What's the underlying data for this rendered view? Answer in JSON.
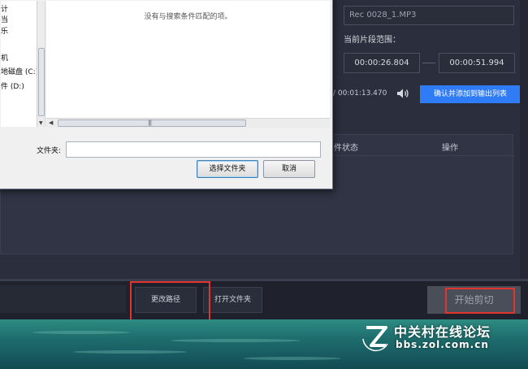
{
  "dialog": {
    "tree_items": [
      "计",
      "当",
      "乐",
      "机",
      "地磁盘 (C:)",
      "件 (D:)"
    ],
    "empty_message": "没有与搜索条件匹配的项。",
    "folder_label": "文件夹:",
    "folder_value": "",
    "select_folder_label": "选择文件夹",
    "cancel_label": "取消"
  },
  "editor": {
    "file_name": "Rec 0028_1.MP3",
    "range_label": "当前片段范围：",
    "start_time": "00:00:26.804",
    "end_time": "00:00:51.994",
    "total_time": "/ 00:01:13.470",
    "confirm_label": "确认并添加到输出列表"
  },
  "output_list": {
    "columns": [
      "件状态",
      "操作"
    ]
  },
  "toolbar": {
    "change_path_label": "更改路径",
    "open_folder_label": "打开文件夹",
    "start_cut_label": "开始剪切"
  },
  "watermark": {
    "title": "中关村在线论坛",
    "url": "bbs.zol.com.cn"
  },
  "colors": {
    "accent_blue": "#2f7cf6",
    "highlight_red": "#e0342c",
    "app_background": "#2b2f3d"
  }
}
